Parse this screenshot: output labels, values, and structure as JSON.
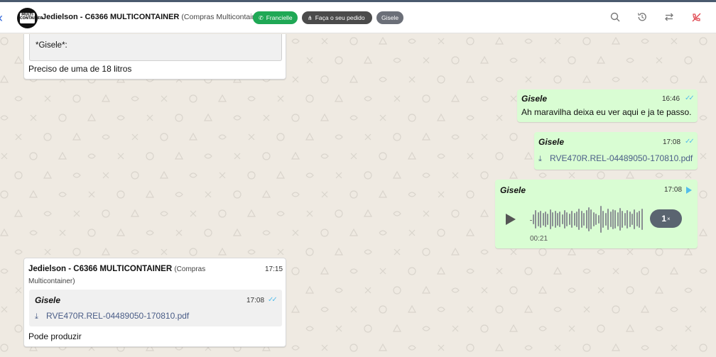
{
  "header": {
    "back_label": "‹",
    "avatar_text": "MULTI CONTAINER",
    "contact_name": "Jedielson - C6366 MULTICONTAINER",
    "contact_sub": "(Compras Multicontainer)",
    "tags": [
      {
        "label": "Francielle",
        "icon": "whatsapp-icon",
        "color": "#1fa855"
      },
      {
        "label": "Faça o seu pedido",
        "icon": "workflow-icon",
        "color": "#4b4b4b"
      },
      {
        "label": "Gisele",
        "color": "#6b6f78"
      }
    ],
    "icons": [
      "search-icon",
      "history-icon",
      "transfer-icon",
      "end-call-icon"
    ]
  },
  "messages": {
    "m1": {
      "quoted_text": "*Gisele*:",
      "text": "Preciso de uma de 18 litros"
    },
    "m2": {
      "author": "Gisele",
      "time": "16:46",
      "text": "Ah maravilha deixa eu ver aqui e ja te passo."
    },
    "m3": {
      "author": "Gisele",
      "time": "17:08",
      "file_name": "RVE470R.REL-04489050-170810.pdf"
    },
    "m4": {
      "author": "Gisele",
      "time": "17:08",
      "duration": "00:21",
      "speed_value": "1",
      "speed_unit": "×"
    },
    "m5": {
      "author": "Jedielson - C6366 MULTICONTAINER",
      "author_sub": "(Compras",
      "author_sub2": "Multicontainer)",
      "time": "17:15",
      "quoted_author": "Gisele",
      "quoted_time": "17:08",
      "quoted_file": "RVE470R.REL-04489050-170810.pdf",
      "text": "Pode produzir"
    }
  },
  "colors": {
    "chat_bg": "#efeae2",
    "outgoing_bubble": "#d9fdd3",
    "read_ticks": "#53bdeb",
    "file_link": "#4a5d87"
  }
}
